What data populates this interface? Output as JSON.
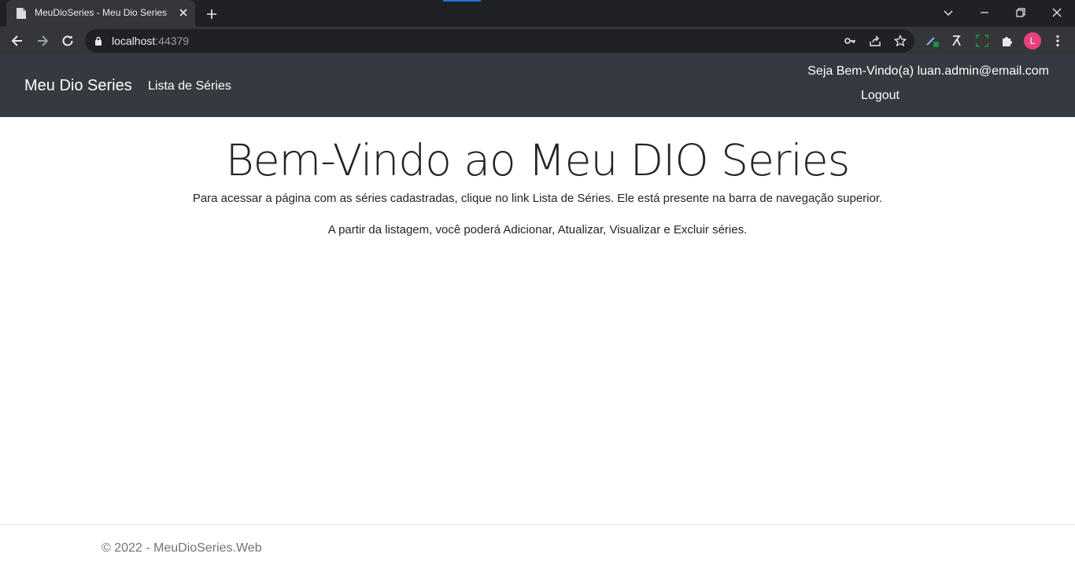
{
  "browser": {
    "tab_title": "MeuDioSeries - Meu Dio Series",
    "url_host": "localhost",
    "url_port": ":44379",
    "profile_initial": "L",
    "icons": [
      "page-favicon-icon",
      "close-icon",
      "plus-icon",
      "chevron-down-icon",
      "minimize-icon",
      "restore-icon",
      "close-window-icon",
      "back-arrow-icon",
      "forward-arrow-icon",
      "reload-icon",
      "lock-icon",
      "key-icon",
      "share-icon",
      "star-icon",
      "extension-icon",
      "puzzle-icon",
      "kebab-menu-icon"
    ]
  },
  "navbar": {
    "brand": "Meu Dio Series",
    "link_series": "Lista de Séries",
    "welcome": "Seja Bem-Vindo(a) luan.admin@email.com",
    "logout": "Logout",
    "background": "#343a40"
  },
  "main": {
    "title": "Bem-Vindo ao Meu DIO Series",
    "paragraph1": "Para acessar a página com as séries cadastradas, clique no link Lista de Séries. Ele está presente na barra de navegação superior.",
    "paragraph2": "A partir da listagem, você poderá Adicionar, Atualizar, Visualizar e Excluir séries."
  },
  "footer": {
    "text": "© 2022 - MeuDioSeries.Web"
  }
}
